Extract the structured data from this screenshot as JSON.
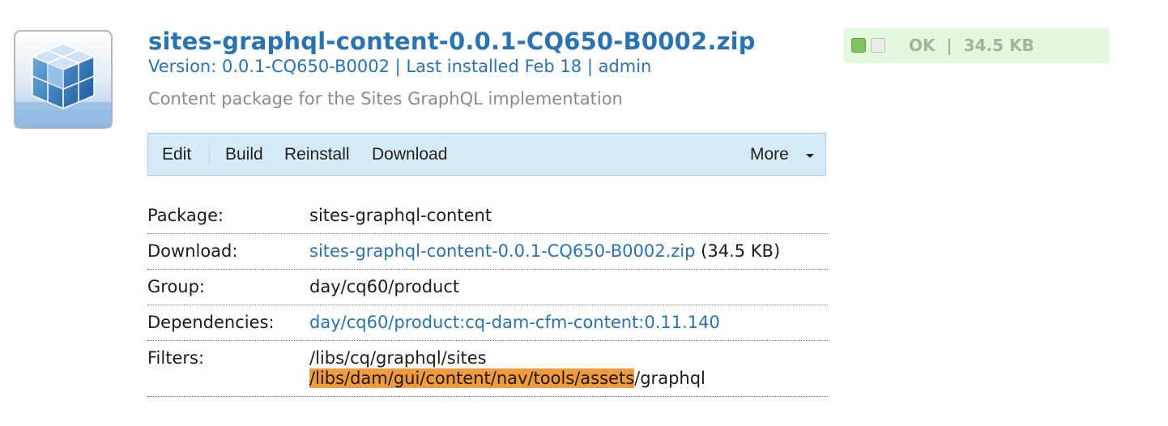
{
  "package_icon": "package-cube-icon",
  "header": {
    "title": "sites-graphql-content-0.0.1-CQ650-B0002.zip",
    "subtitle": "Version: 0.0.1-CQ650-B0002 | Last installed Feb 18 | admin",
    "description": "Content package for the Sites GraphQL implementation"
  },
  "status": {
    "text": "OK  |  34.5 KB",
    "color": "#e3f8dd"
  },
  "toolbar": {
    "edit": "Edit",
    "build": "Build",
    "reinstall": "Reinstall",
    "download": "Download",
    "more": "More"
  },
  "details": {
    "package_label": "Package:",
    "package_value": "sites-graphql-content",
    "download_label": "Download:",
    "download_link": "sites-graphql-content-0.0.1-CQ650-B0002.zip",
    "download_size": " (34.5 KB)",
    "group_label": "Group:",
    "group_value": "day/cq60/product",
    "dependencies_label": "Dependencies:",
    "dependencies_link": "day/cq60/product:cq-dam-cfm-content:0.11.140",
    "filters_label": "Filters:",
    "filter_1": "/libs/cq/graphql/sites",
    "filter_2_highlight": "/libs/dam/gui/content/nav/tools/assets",
    "filter_2_rest": "/graphql"
  },
  "colors": {
    "link": "#2a72b0",
    "toolbar_bg": "#d6eaf8",
    "highlight": "#f29a3c"
  }
}
